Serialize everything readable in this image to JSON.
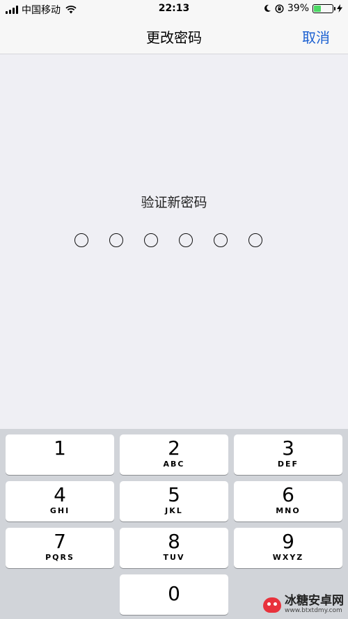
{
  "status_bar": {
    "carrier": "中国移动",
    "time": "22:13",
    "battery_percent_text": "39%",
    "battery_level": 0.39,
    "icons": [
      "signal-icon",
      "wifi-icon",
      "moon-icon",
      "orientation-lock-icon",
      "battery-icon",
      "charging-bolt-icon"
    ]
  },
  "nav": {
    "title": "更改密码",
    "cancel_label": "取消"
  },
  "passcode": {
    "prompt": "验证新密码",
    "length": 6,
    "entered": 0
  },
  "keypad": {
    "keys": [
      {
        "digit": "1",
        "letters": ""
      },
      {
        "digit": "2",
        "letters": "ABC"
      },
      {
        "digit": "3",
        "letters": "DEF"
      },
      {
        "digit": "4",
        "letters": "GHI"
      },
      {
        "digit": "5",
        "letters": "JKL"
      },
      {
        "digit": "6",
        "letters": "MNO"
      },
      {
        "digit": "7",
        "letters": "PQRS"
      },
      {
        "digit": "8",
        "letters": "TUV"
      },
      {
        "digit": "9",
        "letters": "WXYZ"
      },
      {
        "digit": "0",
        "letters": ""
      }
    ]
  },
  "watermark": {
    "name": "冰糖安卓网",
    "url": "www.btxtdmy.com"
  },
  "colors": {
    "accent": "#1a5fd1",
    "background": "#efeff4",
    "keypad_bg": "#d1d4d9",
    "battery_fill": "#4cd964"
  }
}
